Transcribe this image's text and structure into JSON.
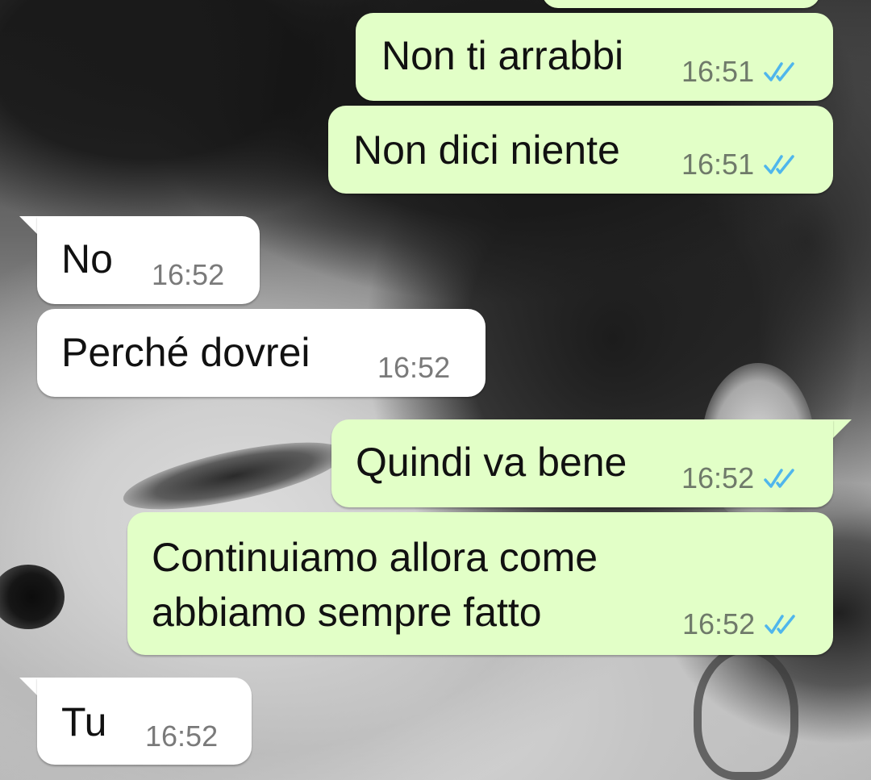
{
  "messages": [
    {
      "direction": "out",
      "text": "Non ti arrabbi",
      "time": "16:51",
      "status": "read"
    },
    {
      "direction": "out",
      "text": "Non dici niente",
      "time": "16:51",
      "status": "read"
    },
    {
      "direction": "in",
      "text": "No",
      "time": "16:52"
    },
    {
      "direction": "in",
      "text": "Perché dovrei",
      "time": "16:52"
    },
    {
      "direction": "out",
      "text": "Quindi va bene",
      "time": "16:52",
      "status": "read"
    },
    {
      "direction": "out",
      "text": "Continuiamo allora come\nabbiamo sempre fatto",
      "time": "16:52",
      "status": "read"
    },
    {
      "direction": "in",
      "text": "Tu",
      "time": "16:52"
    }
  ],
  "colors": {
    "outgoing_bubble": "#e2ffc7",
    "incoming_bubble": "#ffffff",
    "read_ticks": "#4fb6ec"
  },
  "icons": {
    "read_receipt": "double-check-icon"
  }
}
